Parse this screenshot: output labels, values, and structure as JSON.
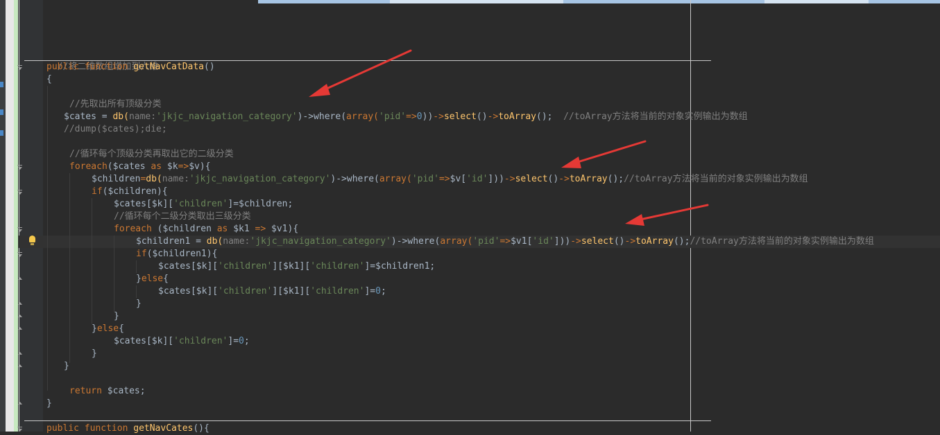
{
  "code": {
    "comment_2d_to_6d": "//将二维数组增加到六维",
    "kw_public": "public",
    "kw_function": "function",
    "fn_getNavCatData": "getNavCatData",
    "parens_open_brace": "()",
    "brace_open": "{",
    "brace_close": "}",
    "comment_top_level": "//先取出所有顶级分类",
    "var_cates": "$cates",
    "op_assign": " = ",
    "fn_db": "db(",
    "hint_name": "name:",
    "str_table": "'jkjc_navigation_category'",
    "arrow_where": ")->where(",
    "fn_array": "array(",
    "str_pid": "'pid'",
    "op_arrow": "=>",
    "num_zero": "0",
    "close_double": "))",
    "arrow_op": "->",
    "fn_select": "select",
    "fn_toArray": "toArray",
    "call_end": "();",
    "comment_toarray": "//toArray方法将当前的对象实例输出为数组",
    "comment_dump": "//dump($cates);die;",
    "comment_loop_top": "//循环每个顶级分类再取出它的二级分类",
    "kw_foreach": "foreach",
    "kw_as": "as",
    "var_k": "$k",
    "var_v": "$v",
    "var_children": "$children",
    "str_id": "'id'",
    "kw_if": "if",
    "str_children": "'children'",
    "comment_loop_second": "//循环每个二级分类取出三级分类",
    "var_k1": "$k1",
    "var_v1": "$v1",
    "var_children1": "$children1",
    "kw_else": "else",
    "kw_return": "return",
    "fn_getNavCates": "getNavCates"
  },
  "colors": {
    "background": "#2b2b2b",
    "keyword": "#cc7832",
    "function": "#ffc66d",
    "string": "#6a8759",
    "number": "#6897bb",
    "comment": "#808080",
    "text": "#a9b7c6",
    "arrow_annotation": "#e53935"
  },
  "icons": [
    "fold-open-icon",
    "fold-close-icon",
    "intention-bulb-icon"
  ]
}
